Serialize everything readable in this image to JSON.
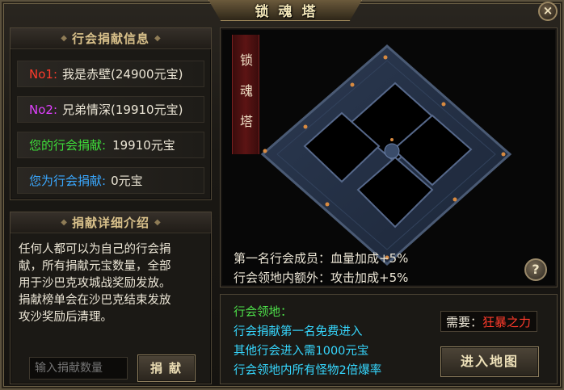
{
  "window": {
    "title": "锁魂塔",
    "close_label": "×"
  },
  "guild_info": {
    "heading": "行会捐献信息",
    "rank1_label": "No1:",
    "rank1_value": "我是赤壁(24900元宝)",
    "rank2_label": "No2:",
    "rank2_value": "兄弟情深(19910元宝)",
    "my_guild_label": "您的行会捐献:",
    "my_guild_value": "19910元宝",
    "my_contrib_label": "您为行会捐献:",
    "my_contrib_value": "0元宝"
  },
  "details": {
    "heading": "捐献详细介绍",
    "lines": [
      "任何人都可以为自己的行会捐",
      "献，所有捐献元宝数量，全部",
      "用于沙巴克攻城战奖励发放。",
      "捐献榜单会在沙巴克结束发放",
      "攻沙奖励后清理。"
    ],
    "input_placeholder": "输入捐献数量",
    "donate_button": "捐献"
  },
  "map": {
    "banner_chars": [
      "锁",
      "魂",
      "塔"
    ],
    "bonus_line1": "第一名行会成员：血量加成+5%",
    "bonus_line2": "行会领地内额外：攻击加成+5%",
    "help_label": "?"
  },
  "territory": {
    "heading": "行会领地：",
    "line1": "行会捐献第一名免费进入",
    "line2": "其他行会进入需1000元宝",
    "line3": "行会领地内所有怪物2倍爆率",
    "need_label": "需要：",
    "need_value": "狂暴之力",
    "enter_button": "进入地图"
  }
}
